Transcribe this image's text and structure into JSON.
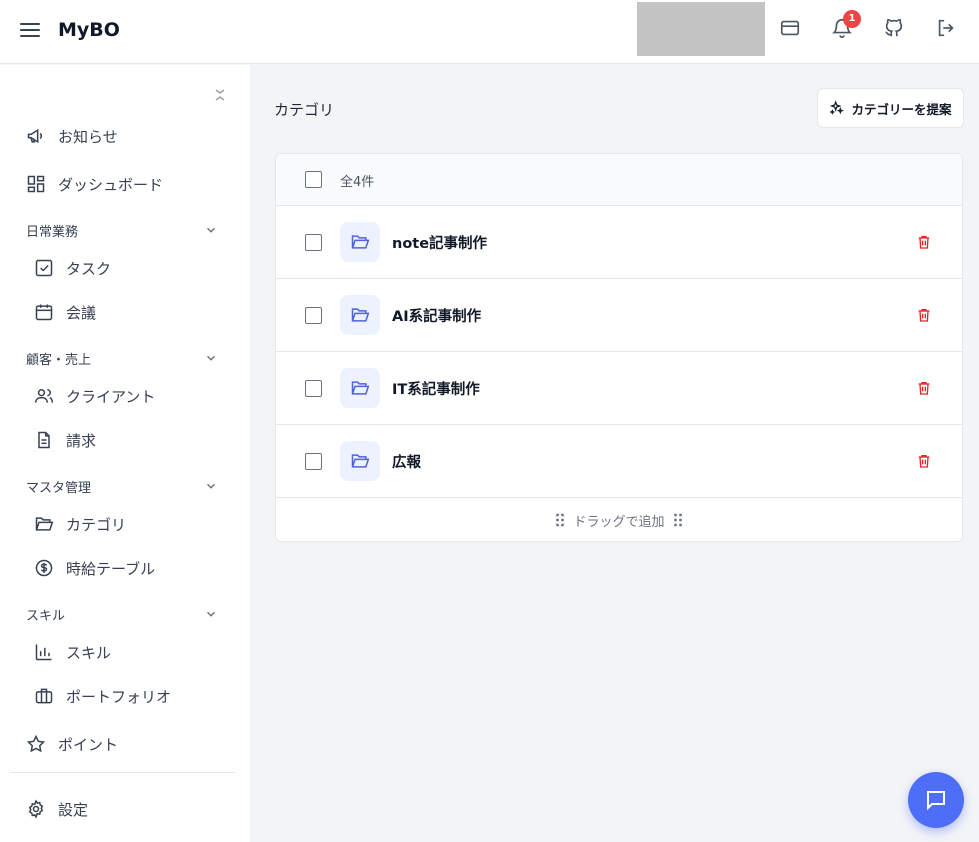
{
  "header": {
    "brand": "MyBO",
    "notification_count": "1"
  },
  "sidebar": {
    "top_items": [
      {
        "label": "お知らせ",
        "icon": "megaphone-icon"
      },
      {
        "label": "ダッシュボード",
        "icon": "dashboard-icon"
      }
    ],
    "groups": [
      {
        "title": "日常業務",
        "items": [
          {
            "label": "タスク",
            "icon": "checkbox-icon"
          },
          {
            "label": "会議",
            "icon": "calendar-icon"
          }
        ]
      },
      {
        "title": "顧客・売上",
        "items": [
          {
            "label": "クライアント",
            "icon": "users-icon"
          },
          {
            "label": "請求",
            "icon": "document-icon"
          }
        ]
      },
      {
        "title": "マスタ管理",
        "items": [
          {
            "label": "カテゴリ",
            "icon": "folder-icon"
          },
          {
            "label": "時給テーブル",
            "icon": "dollar-icon"
          }
        ]
      },
      {
        "title": "スキル",
        "items": [
          {
            "label": "スキル",
            "icon": "bar-chart-icon"
          },
          {
            "label": "ポートフォリオ",
            "icon": "briefcase-icon"
          }
        ]
      }
    ],
    "points_label": "ポイント",
    "settings_label": "設定"
  },
  "main": {
    "title": "カテゴリ",
    "suggest_button": "カテゴリーを提案",
    "count_label": "全4件",
    "categories": [
      {
        "name": "note記事制作"
      },
      {
        "name": "AI系記事制作"
      },
      {
        "name": "IT系記事制作"
      },
      {
        "name": "広報"
      }
    ],
    "drag_label": "ドラッグで追加"
  },
  "colors": {
    "accent": "#4f6ef7",
    "danger": "#dc2626",
    "folder_tile": "#eef2ff"
  }
}
